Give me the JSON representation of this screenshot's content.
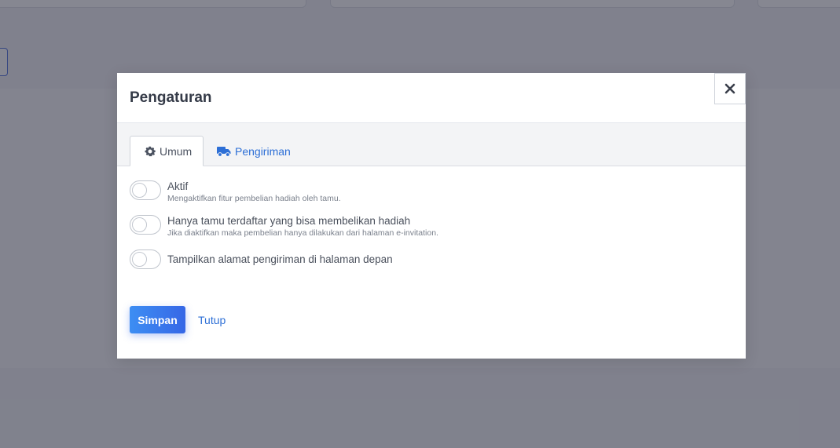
{
  "modal": {
    "title": "Pengaturan",
    "close_icon": "close-icon"
  },
  "tabs": [
    {
      "label": "Umum",
      "icon": "gear-icon",
      "active": true
    },
    {
      "label": "Pengiriman",
      "icon": "truck-icon",
      "active": false
    }
  ],
  "settings": [
    {
      "label": "Aktif",
      "description": "Mengaktifkan fitur pembelian hadiah oleh tamu.",
      "enabled": false
    },
    {
      "label": "Hanya tamu terdaftar yang bisa membelikan hadiah",
      "description": "Jika diaktifkan maka pembelian hanya dilakukan dari halaman e-invitation.",
      "enabled": false
    },
    {
      "label": "Tampilkan alamat pengiriman di halaman depan",
      "enabled": false
    }
  ],
  "footer": {
    "save_label": "Simpan",
    "close_label": "Tutup"
  },
  "colors": {
    "accent": "#3667e6",
    "link": "#2d6fd6",
    "overlay": "#3c3e4e"
  }
}
